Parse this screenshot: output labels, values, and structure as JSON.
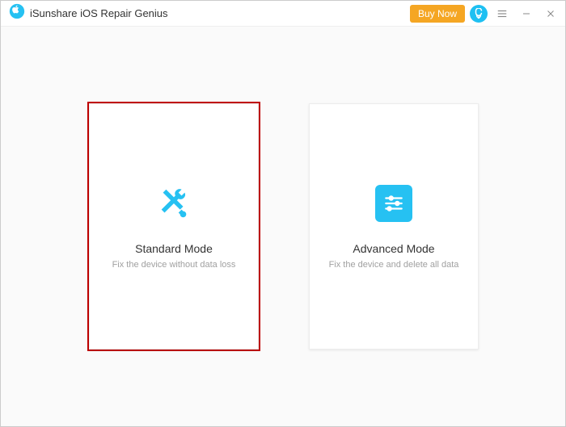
{
  "titlebar": {
    "app_name": "iSunshare iOS Repair Genius",
    "buy_label": "Buy Now"
  },
  "main": {
    "standard": {
      "title": "Standard Mode",
      "subtitle": "Fix the device without data loss"
    },
    "advanced": {
      "title": "Advanced Mode",
      "subtitle": "Fix the device and delete all data"
    }
  },
  "colors": {
    "accent": "#26c1f2",
    "buy": "#f5a623",
    "highlight_border": "#c00000"
  }
}
